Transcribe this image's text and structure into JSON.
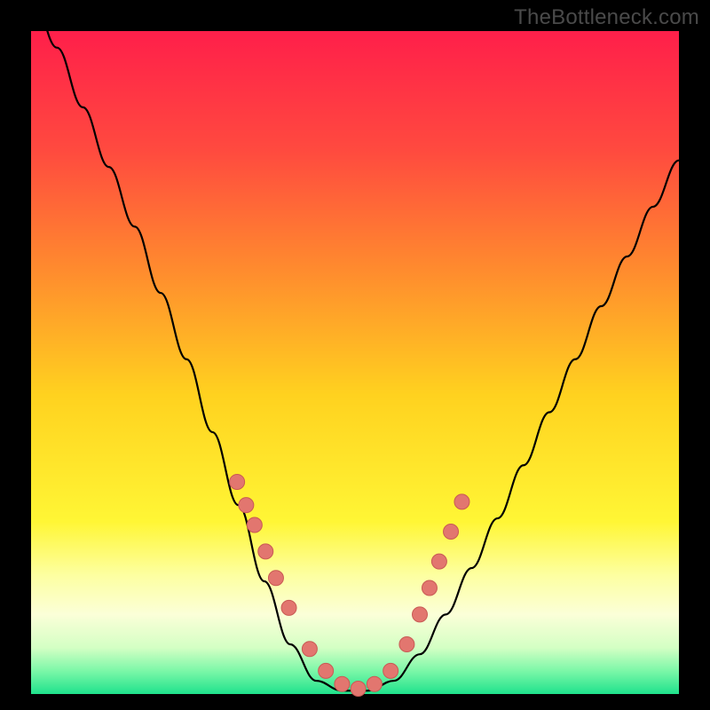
{
  "watermark": "TheBottleneck.com",
  "colors": {
    "frame": "#000000",
    "curve_stroke": "#000000",
    "dot_fill": "#e2766f",
    "dot_stroke": "#c95a54",
    "gradient_stops": [
      {
        "offset": 0.0,
        "color": "#ff1f4a"
      },
      {
        "offset": 0.18,
        "color": "#ff4a3f"
      },
      {
        "offset": 0.36,
        "color": "#ff8b2e"
      },
      {
        "offset": 0.55,
        "color": "#ffd21f"
      },
      {
        "offset": 0.74,
        "color": "#fff635"
      },
      {
        "offset": 0.82,
        "color": "#fdffa0"
      },
      {
        "offset": 0.88,
        "color": "#fbffd8"
      },
      {
        "offset": 0.93,
        "color": "#d4ffc4"
      },
      {
        "offset": 0.965,
        "color": "#7cf7a8"
      },
      {
        "offset": 1.0,
        "color": "#1fe28c"
      }
    ]
  },
  "chart_data": {
    "type": "line",
    "title": "",
    "xlabel": "",
    "ylabel": "",
    "xlim": [
      0,
      1
    ],
    "ylim": [
      0,
      1
    ],
    "x": [
      0.0,
      0.04,
      0.08,
      0.12,
      0.16,
      0.2,
      0.24,
      0.28,
      0.32,
      0.36,
      0.4,
      0.44,
      0.48,
      0.52,
      0.56,
      0.6,
      0.64,
      0.68,
      0.72,
      0.76,
      0.8,
      0.84,
      0.88,
      0.92,
      0.96,
      1.0
    ],
    "values": [
      1.06,
      0.975,
      0.885,
      0.795,
      0.705,
      0.605,
      0.505,
      0.395,
      0.285,
      0.17,
      0.075,
      0.02,
      0.005,
      0.005,
      0.02,
      0.06,
      0.12,
      0.19,
      0.265,
      0.345,
      0.425,
      0.505,
      0.585,
      0.66,
      0.735,
      0.805
    ],
    "series": [
      {
        "name": "dots",
        "type": "scatter",
        "x": [
          0.318,
          0.332,
          0.345,
          0.362,
          0.378,
          0.398,
          0.43,
          0.455,
          0.48,
          0.505,
          0.53,
          0.555,
          0.58,
          0.6,
          0.615,
          0.63,
          0.648,
          0.665
        ],
        "values": [
          0.32,
          0.285,
          0.255,
          0.215,
          0.175,
          0.13,
          0.068,
          0.035,
          0.015,
          0.008,
          0.015,
          0.035,
          0.075,
          0.12,
          0.16,
          0.2,
          0.245,
          0.29
        ]
      }
    ]
  }
}
